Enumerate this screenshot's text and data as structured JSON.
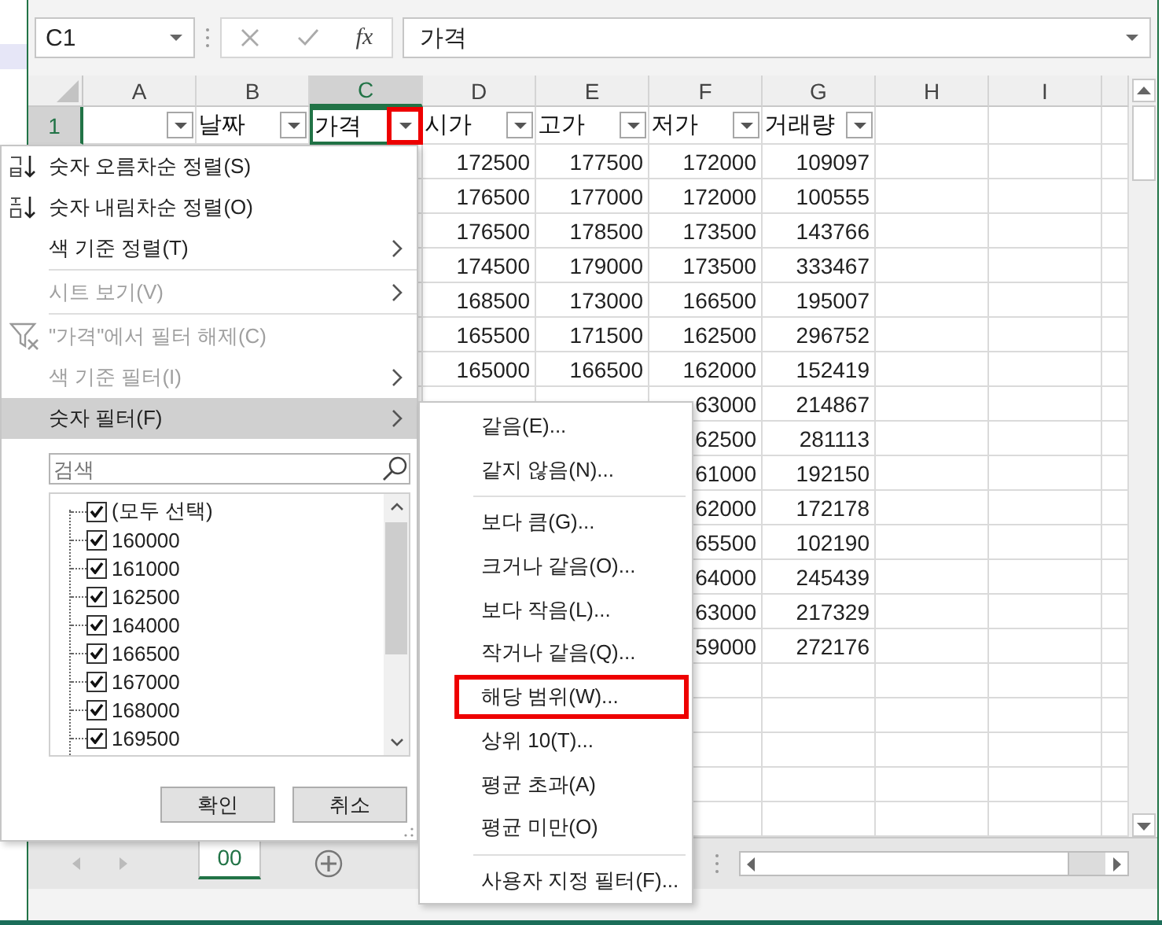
{
  "name_box": {
    "value": "C1"
  },
  "function_label": "fx",
  "formula": "가격",
  "columns": [
    {
      "label": "A",
      "selected": false
    },
    {
      "label": "B",
      "selected": false
    },
    {
      "label": "C",
      "selected": true
    },
    {
      "label": "D",
      "selected": false
    },
    {
      "label": "E",
      "selected": false
    },
    {
      "label": "F",
      "selected": false
    },
    {
      "label": "G",
      "selected": false
    },
    {
      "label": "H",
      "selected": false
    },
    {
      "label": "I",
      "selected": false
    }
  ],
  "header_row": {
    "number": "1",
    "selected": true,
    "cells": [
      {
        "selected": false,
        "annotated": false
      },
      {
        "text": "날짜",
        "selected": false,
        "annotated": false
      },
      {
        "text": "가격",
        "selected": true,
        "annotated": true
      },
      {
        "text": "시가",
        "selected": false,
        "annotated": false
      },
      {
        "text": "고가",
        "selected": false,
        "annotated": false
      },
      {
        "text": "저가",
        "selected": false,
        "annotated": false
      },
      {
        "text": "거래량",
        "selected": false,
        "annotated": false
      }
    ]
  },
  "rows": [
    {
      "d": "172500",
      "e": "177500",
      "f": "172000",
      "g": "109097"
    },
    {
      "d": "176500",
      "e": "177000",
      "f": "172000",
      "g": "100555"
    },
    {
      "d": "176500",
      "e": "178500",
      "f": "173500",
      "g": "143766"
    },
    {
      "d": "174500",
      "e": "179000",
      "f": "173500",
      "g": "333467"
    },
    {
      "d": "168500",
      "e": "173000",
      "f": "166500",
      "g": "195007"
    },
    {
      "d": "165500",
      "e": "171500",
      "f": "162500",
      "g": "296752"
    },
    {
      "d": "165000",
      "e": "166500",
      "f": "162000",
      "g": "152419"
    },
    {
      "f": "63000",
      "g": "214867"
    },
    {
      "f": "62500",
      "g": "281113"
    },
    {
      "f": "61000",
      "g": "192150"
    },
    {
      "f": "62000",
      "g": "172178"
    },
    {
      "f": "65500",
      "g": "102190"
    },
    {
      "f": "64000",
      "g": "245439"
    },
    {
      "f": "63000",
      "g": "217329"
    },
    {
      "f": "59000",
      "g": "272176"
    }
  ],
  "sort_menu": {
    "items": [
      {
        "kind": "sort-ascending",
        "label": "숫자 오름차순 정렬(S)",
        "disabled": false,
        "selected": false
      },
      {
        "kind": "sort-descending",
        "label": "숫자 내림차순 정렬(O)",
        "disabled": false,
        "selected": false
      },
      {
        "kind": "submenu",
        "label": "색 기준 정렬(T)",
        "disabled": false,
        "selected": false
      },
      {
        "kind": "separator"
      },
      {
        "kind": "submenu",
        "label": "시트 보기(V)",
        "disabled": true,
        "selected": false
      },
      {
        "kind": "separator"
      },
      {
        "kind": "clear-filter",
        "label": "\"가격\"에서 필터 해제(C)",
        "disabled": true,
        "selected": false
      },
      {
        "kind": "submenu",
        "label": "색 기준 필터(I)",
        "disabled": true,
        "selected": false
      },
      {
        "kind": "submenu",
        "label": "숫자 필터(F)",
        "disabled": false,
        "selected": true
      }
    ]
  },
  "search": {
    "placeholder": "검색"
  },
  "values": [
    {
      "label": "(모두 선택)",
      "checked": true
    },
    {
      "label": "160000",
      "checked": true
    },
    {
      "label": "161000",
      "checked": true
    },
    {
      "label": "162500",
      "checked": true
    },
    {
      "label": "164000",
      "checked": true
    },
    {
      "label": "166500",
      "checked": true
    },
    {
      "label": "167000",
      "checked": true
    },
    {
      "label": "168000",
      "checked": true
    },
    {
      "label": "169500",
      "checked": true
    }
  ],
  "buttons": [
    "확인",
    "취소"
  ],
  "number_filter_menu": {
    "items": [
      {
        "kind": "item",
        "label": "같음(E)...",
        "annotated": false
      },
      {
        "kind": "item",
        "label": "같지 않음(N)...",
        "annotated": false
      },
      {
        "kind": "separator"
      },
      {
        "kind": "item",
        "label": "보다 큼(G)...",
        "annotated": false
      },
      {
        "kind": "item",
        "label": "크거나 같음(O)...",
        "annotated": false
      },
      {
        "kind": "item",
        "label": "보다 작음(L)...",
        "annotated": false
      },
      {
        "kind": "item",
        "label": "작거나 같음(Q)...",
        "annotated": false
      },
      {
        "kind": "item",
        "label": "해당 범위(W)...",
        "annotated": true
      },
      {
        "kind": "item",
        "label": "상위 10(T)...",
        "annotated": false
      },
      {
        "kind": "item",
        "label": "평균 초과(A)",
        "annotated": false
      },
      {
        "kind": "item",
        "label": "평균 미만(O)",
        "annotated": false
      },
      {
        "kind": "separator"
      },
      {
        "kind": "item",
        "label": "사용자 지정 필터(F)...",
        "annotated": false
      }
    ]
  },
  "sheet_tabs": [
    {
      "label": "00",
      "selected": true
    }
  ]
}
